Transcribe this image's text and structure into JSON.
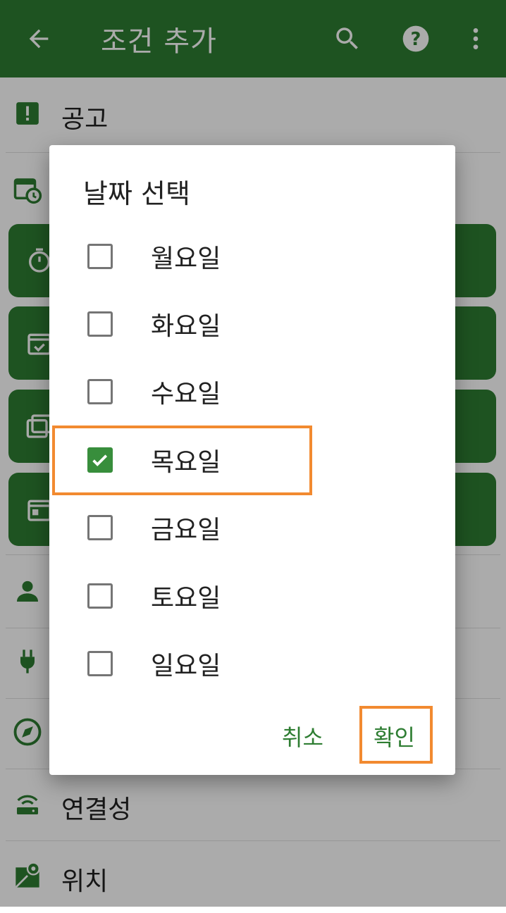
{
  "appbar": {
    "title": "조건 추가",
    "icons": [
      "back-arrow-icon",
      "search-icon",
      "help-icon",
      "more-vert-icon"
    ],
    "color": "#2e7d32"
  },
  "list": {
    "announce_label": "공고",
    "connectivity_label": "연결성",
    "location_label": "위치"
  },
  "dialog": {
    "title": "날짜 선택",
    "days": [
      {
        "label": "월요일",
        "checked": false
      },
      {
        "label": "화요일",
        "checked": false
      },
      {
        "label": "수요일",
        "checked": false
      },
      {
        "label": "목요일",
        "checked": true
      },
      {
        "label": "금요일",
        "checked": false
      },
      {
        "label": "토요일",
        "checked": false
      },
      {
        "label": "일요일",
        "checked": false
      }
    ],
    "cancel_label": "취소",
    "ok_label": "확인"
  },
  "colors": {
    "accent": "#2e7d32",
    "checkbox_checked": "#388e3c",
    "highlight": "#f28a30"
  }
}
